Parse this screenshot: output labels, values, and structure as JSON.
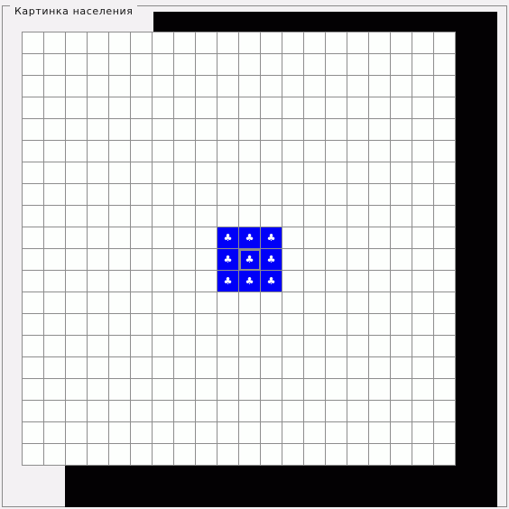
{
  "window": {
    "group_title": "Картинка населения"
  },
  "grid": {
    "columns": 20,
    "rows": 20,
    "populated_icon": "person-icon",
    "populated_glyph": "♣",
    "populated_cells": [
      {
        "row": 9,
        "col": 9
      },
      {
        "row": 9,
        "col": 10
      },
      {
        "row": 9,
        "col": 11
      },
      {
        "row": 10,
        "col": 9
      },
      {
        "row": 10,
        "col": 10
      },
      {
        "row": 10,
        "col": 11
      },
      {
        "row": 11,
        "col": 9
      },
      {
        "row": 11,
        "col": 10
      },
      {
        "row": 11,
        "col": 11
      }
    ],
    "selected_cell": {
      "row": 10,
      "col": 10
    }
  },
  "colors": {
    "populated": "#0000f8",
    "empty": "#fdfffd",
    "gridline": "#8d8d8d",
    "shadow": "#030103"
  }
}
